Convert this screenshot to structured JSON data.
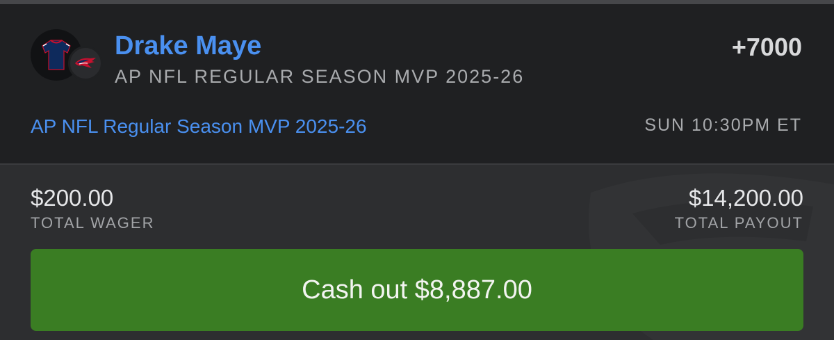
{
  "bet": {
    "player_name": "Drake Maye",
    "market_subtitle": "AP NFL REGULAR SEASON MVP 2025-26",
    "odds": "+7000",
    "event_link": "AP NFL Regular Season MVP 2025-26",
    "event_time": "SUN 10:30PM ET"
  },
  "summary": {
    "total_wager_amount": "$200.00",
    "total_wager_label": "TOTAL WAGER",
    "total_payout_amount": "$14,200.00",
    "total_payout_label": "TOTAL PAYOUT"
  },
  "cashout": {
    "label": "Cash out $8,887.00"
  },
  "icons": {
    "avatar": "jersey-icon",
    "team": "patriots-logo-icon",
    "watermark": "sportsbook-shield-watermark"
  },
  "colors": {
    "accent_blue": "#4a90f0",
    "cashout_green": "#3a7d23",
    "header_bg": "#1f2022",
    "footer_bg": "#2d2e30"
  }
}
